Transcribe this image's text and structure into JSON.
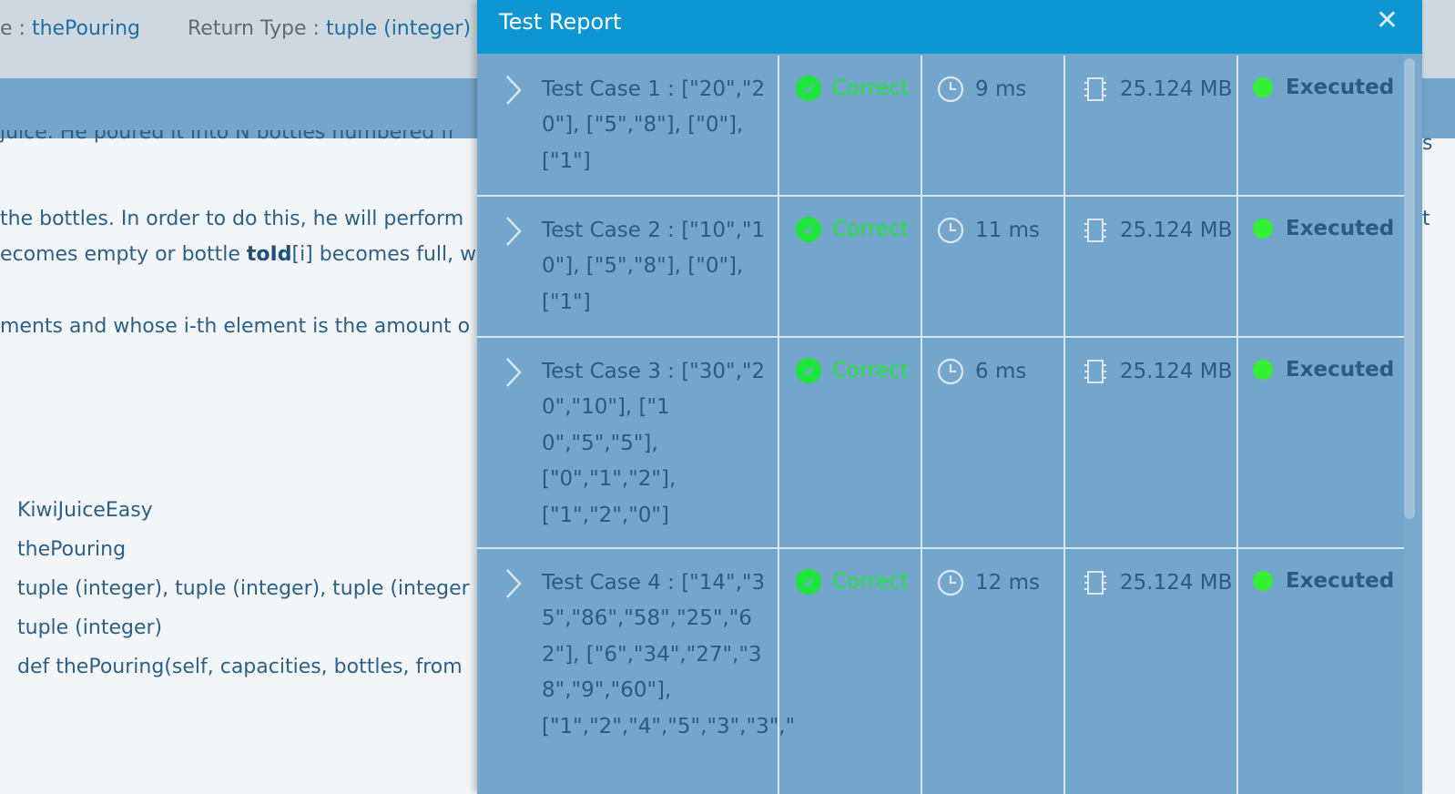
{
  "background": {
    "header": {
      "method_label": "e : ",
      "method_value": "thePouring",
      "return_label": "Return Type : ",
      "return_value": "tuple (integer)"
    },
    "statement_lines": [
      {
        "text": "juice. He poured it into N bottles numbered fr",
        "bold": ""
      },
      {
        "text": "the bottles. In order to do this, he will perform",
        "bold": ""
      },
      {
        "pre": "ecomes empty or bottle ",
        "bold": "toId",
        "post": "[i] becomes full, w"
      },
      {
        "text": "ments and whose i-th element is the amount o",
        "bold": ""
      }
    ],
    "right_edge": [
      "s",
      "t"
    ],
    "signature": [
      "KiwiJuiceEasy",
      "thePouring",
      "tuple (integer), tuple (integer), tuple (integer",
      "tuple (integer)",
      "def thePouring(self, capacities, bottles, from"
    ]
  },
  "modal": {
    "title": "Test Report",
    "close_symbol": "✕",
    "rows": [
      {
        "label": "Test Case 1 : [\"20\",\"20\"], [\"5\",\"8\"], [\"0\"], [\"1\"]",
        "status": "Correct",
        "time": "9 ms",
        "memory": "25.124 MB",
        "state": "Executed"
      },
      {
        "label": "Test Case 2 : [\"10\",\"10\"], [\"5\",\"8\"], [\"0\"], [\"1\"]",
        "status": "Correct",
        "time": "11 ms",
        "memory": "25.124 MB",
        "state": "Executed"
      },
      {
        "label": "Test Case 3 : [\"30\",\"20\",\"10\"], [\"10\",\"5\",\"5\"], [\"0\",\"1\",\"2\"], [\"1\",\"2\",\"0\"]",
        "status": "Correct",
        "time": "6 ms",
        "memory": "25.124 MB",
        "state": "Executed"
      },
      {
        "label": "Test Case 4 : [\"14\",\"35\",\"86\",\"58\",\"25\",\"62\"], [\"6\",\"34\",\"27\",\"38\",\"9\",\"60\"], [\"1\",\"2\",\"4\",\"5\",\"3\",\"3\",\"",
        "status": "Correct",
        "time": "12 ms",
        "memory": "25.124 MB",
        "state": "Executed"
      }
    ]
  },
  "colors": {
    "modal_header": "#0d96d2",
    "modal_body": "#74a5ca",
    "correct_green": "#1fe63a",
    "executed_dot": "#34f034"
  }
}
